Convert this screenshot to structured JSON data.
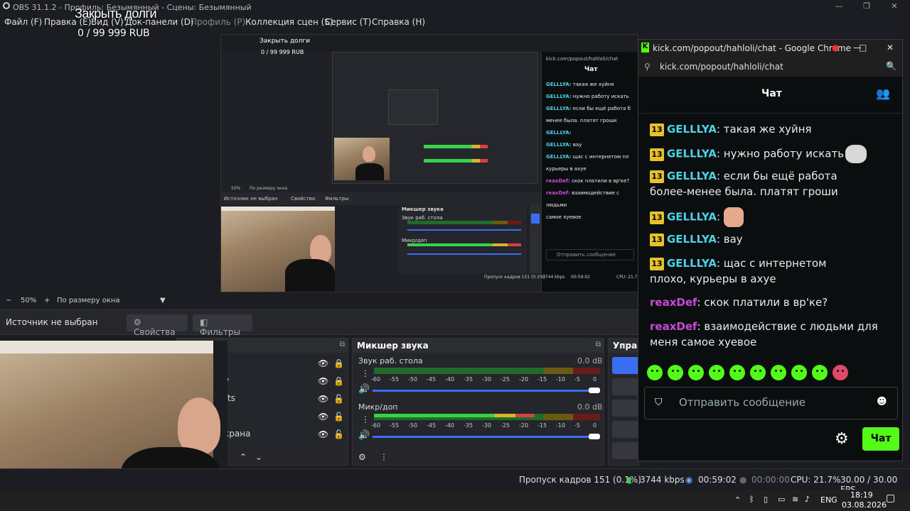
{
  "window": {
    "title": "OBS 31.1.2 - Профиль: Безымянный - Сцены: Безымянный",
    "controls": [
      "—",
      "❐",
      "✕"
    ]
  },
  "overlay": {
    "title": "Закрыть долги",
    "goal": "0 / 99 999 RUB"
  },
  "menu": {
    "file": "Файл (F)",
    "edit": "Правка (E)",
    "view": "Вид (V)",
    "docks": "Док-панели (D)",
    "profile": "Профиль (P)",
    "scene_collection": "Коллекция сцен (S)",
    "tools": "Сервис (T)",
    "help": "Справка (H)"
  },
  "zoom": {
    "minus": "−",
    "value": "50%",
    "plus": "+",
    "mode": "По размеру окна"
  },
  "source_bar": {
    "no_source": "Источник не выбран",
    "properties": "Свойства",
    "filters": "Фильтры"
  },
  "sources": {
    "items": [
      {
        "label": "у"
      },
      {
        "label": "rts"
      },
      {
        "label": ""
      },
      {
        "label": "крана"
      }
    ]
  },
  "mixer": {
    "title": "Микшер звука",
    "channels": [
      {
        "name": "Звук раб. стола",
        "db": "0.0 dB",
        "level": 1.0
      },
      {
        "name": "Микр/доп",
        "db": "0.0 dB",
        "level": 1.0
      }
    ],
    "scale": [
      "-60",
      "-55",
      "-50",
      "-45",
      "-40",
      "-35",
      "-30",
      "-25",
      "-20",
      "-15",
      "-10",
      "-5",
      "0"
    ]
  },
  "controls_panel": {
    "title": "Управл"
  },
  "status": {
    "dropped": "Пропуск кадров 151 (0.1%)",
    "bitrate": "3744 kbps",
    "stream_time": "00:59:02",
    "rec_time": "00:00:00",
    "cpu": "CPU: 21.7%",
    "fps": "30.00 / 30.00 FPS"
  },
  "taskbar": {
    "lang": "ENG",
    "time": "18:19",
    "date": "03.08.2026"
  },
  "chat_window": {
    "title": "kick.com/popout/hahloli/chat - Google Chrome",
    "url": "kick.com/popout/hahloli/chat",
    "header": "Чат",
    "messages": [
      {
        "badge": "13",
        "user": "GELLLYA",
        "text": "такая же хуйня"
      },
      {
        "badge": "13",
        "user": "GELLLYA",
        "text": "нужно работу искать"
      },
      {
        "badge": "13",
        "user": "GELLLYA",
        "text": "если бы ещё работа более-менее была. платят гроши"
      },
      {
        "badge": "13",
        "user": "GELLLYA",
        "text": ""
      },
      {
        "badge": "13",
        "user": "GELLLYA",
        "text": "вау"
      },
      {
        "badge": "13",
        "user": "GELLLYA",
        "text": "щас с интернетом плохо, курьеры в ахуе"
      },
      {
        "badge": "",
        "user": "reaxDef",
        "text": "скок платили в вр'ке?"
      },
      {
        "badge": "",
        "user": "reaxDef",
        "text": "взаимодействие с людьми для меня самое хуевое"
      }
    ],
    "input_placeholder": "Отправить сообщение",
    "send_label": "Чат",
    "colors": {
      "kick_green": "#53fc18",
      "badge": "#e8c02a",
      "user_cyan": "#4cd2e6",
      "user_purple": "#c74ad9"
    }
  },
  "nested_preview": {
    "title": "Закрыть долги",
    "goal": "0 / 99 999 RUB",
    "chat_header": "Чат",
    "no_source": "Источник не выбран",
    "properties": "Свойства",
    "filters": "Фильтры",
    "mixer": "Микшер звука",
    "desktop_audio": "Звук раб. стола",
    "mic": "Микр/доп",
    "zoom": "50%",
    "zoom_mode": "По размеру окна",
    "dropped": "Пропуск кадров 151 (0.1%)",
    "bitrate": "3744 kbps",
    "stream_time": "00:59:02",
    "cpu": "CPU: 21.7",
    "send_placeholder": "Отправить сообщение",
    "chat_url": "kick.com/popout/hahloli/chat"
  }
}
